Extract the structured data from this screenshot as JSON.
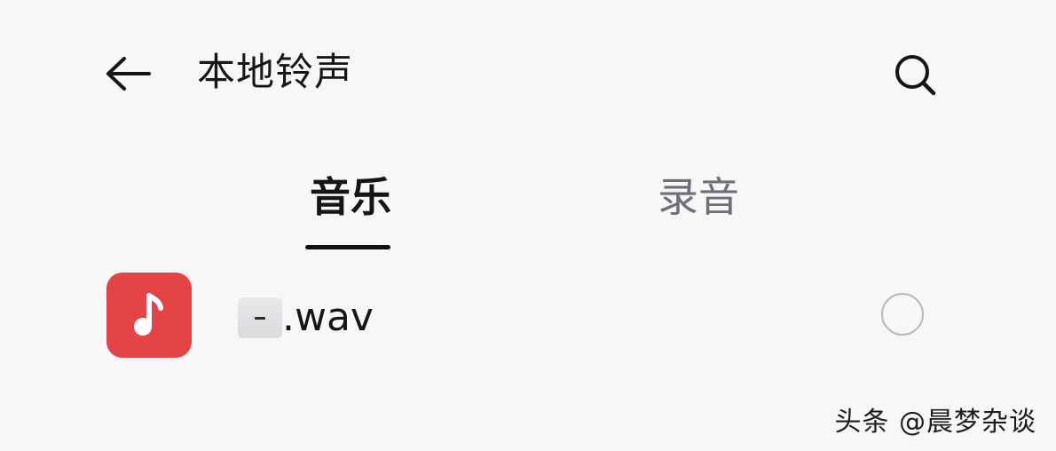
{
  "header": {
    "back_icon": "arrow-left-icon",
    "title": "本地铃声",
    "search_icon": "search-icon"
  },
  "tabs": [
    {
      "label": "音乐",
      "active": true
    },
    {
      "label": "录音",
      "active": false
    }
  ],
  "list": {
    "items": [
      {
        "icon": "music-note-icon",
        "icon_color": "#e44445",
        "file_name": ".wav",
        "selected": false
      }
    ]
  },
  "watermark": {
    "text": "头条 @晨梦杂谈"
  }
}
